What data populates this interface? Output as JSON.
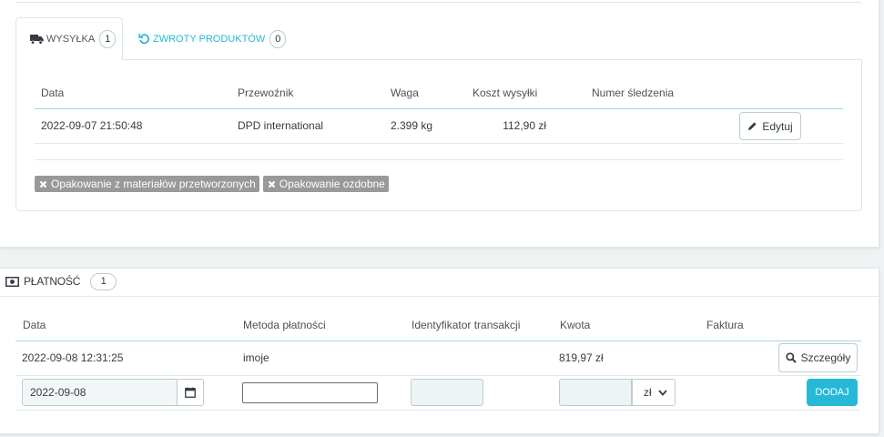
{
  "shipping": {
    "tabs": [
      {
        "label": "WYSYŁKA",
        "count": "1",
        "icon": "truck-icon",
        "active": true
      },
      {
        "label": "ZWROTY PRODUKTÓW",
        "count": "0",
        "icon": "undo-icon",
        "active": false
      }
    ],
    "headers": [
      "Data",
      "Przewoźnik",
      "Waga",
      "Koszt wysyłki",
      "Numer śledzenia"
    ],
    "rows": [
      {
        "date": "2022-09-07 21:50:48",
        "carrier": "DPD international",
        "weight": "2.399 kg",
        "cost": "112,90 zł",
        "edit_label": "Edytuj"
      }
    ],
    "packaging_labels": [
      "Opakowanie z materiałów przetworzonych",
      "Opakowanie ozdobne"
    ]
  },
  "payment": {
    "title": "PŁATNOŚĆ",
    "count": "1",
    "icon": "money-icon",
    "headers": [
      "Data",
      "Metoda płatności",
      "Identyfikator transakcji",
      "Kwota",
      "Faktura"
    ],
    "rows": [
      {
        "date": "2022-09-08 12:31:25",
        "method": "imoje",
        "amount": "819,97 zł",
        "details_label": "Szczegóły"
      }
    ],
    "form": {
      "date_value": "2022-09-08",
      "currency": "zł",
      "add_label": "DODAJ"
    }
  },
  "colors": {
    "accent": "#25b9d7",
    "label_bg": "#999999",
    "page_bg": "#eff1f2",
    "panel_border": "#dbe6e9",
    "header_rule": "#a8d4e6"
  }
}
